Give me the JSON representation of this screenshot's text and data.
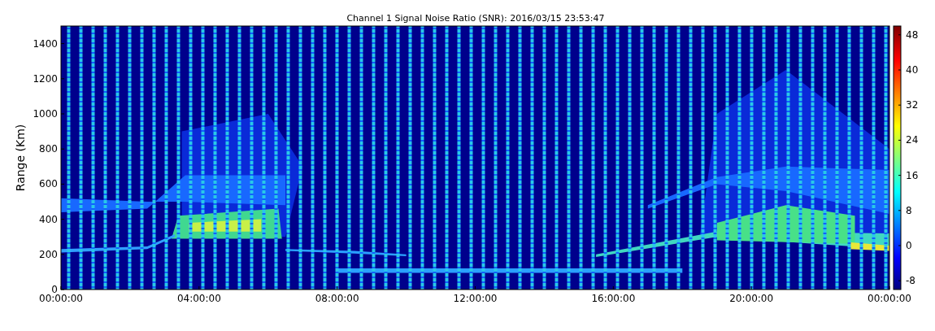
{
  "title": "Channel 1 Signal Noise Ratio (SNR): 2016/03/15 23:53:47",
  "ylabel": "Range (Km)",
  "yticks": [
    "1400",
    "1200",
    "1000",
    "800",
    "600",
    "400",
    "200",
    "0"
  ],
  "xticks": [
    "00:00:00",
    "04:00:00",
    "08:00:00",
    "12:00:00",
    "16:00:00",
    "20:00:00",
    "00:00:00"
  ],
  "colorbar": {
    "ticks": [
      "48",
      "40",
      "32",
      "24",
      "16",
      "8",
      "0",
      "-8"
    ]
  }
}
